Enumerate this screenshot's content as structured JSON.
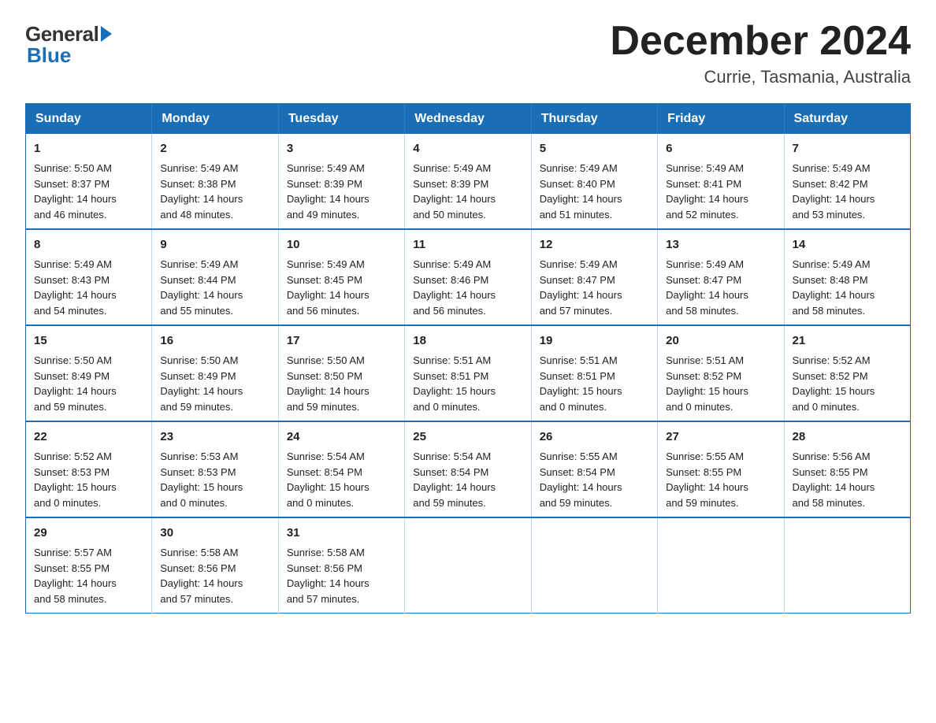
{
  "logo": {
    "general": "General",
    "blue": "Blue"
  },
  "header": {
    "month": "December 2024",
    "location": "Currie, Tasmania, Australia"
  },
  "weekdays": [
    "Sunday",
    "Monday",
    "Tuesday",
    "Wednesday",
    "Thursday",
    "Friday",
    "Saturday"
  ],
  "weeks": [
    [
      {
        "day": "1",
        "sunrise": "5:50 AM",
        "sunset": "8:37 PM",
        "daylight": "14 hours and 46 minutes."
      },
      {
        "day": "2",
        "sunrise": "5:49 AM",
        "sunset": "8:38 PM",
        "daylight": "14 hours and 48 minutes."
      },
      {
        "day": "3",
        "sunrise": "5:49 AM",
        "sunset": "8:39 PM",
        "daylight": "14 hours and 49 minutes."
      },
      {
        "day": "4",
        "sunrise": "5:49 AM",
        "sunset": "8:39 PM",
        "daylight": "14 hours and 50 minutes."
      },
      {
        "day": "5",
        "sunrise": "5:49 AM",
        "sunset": "8:40 PM",
        "daylight": "14 hours and 51 minutes."
      },
      {
        "day": "6",
        "sunrise": "5:49 AM",
        "sunset": "8:41 PM",
        "daylight": "14 hours and 52 minutes."
      },
      {
        "day": "7",
        "sunrise": "5:49 AM",
        "sunset": "8:42 PM",
        "daylight": "14 hours and 53 minutes."
      }
    ],
    [
      {
        "day": "8",
        "sunrise": "5:49 AM",
        "sunset": "8:43 PM",
        "daylight": "14 hours and 54 minutes."
      },
      {
        "day": "9",
        "sunrise": "5:49 AM",
        "sunset": "8:44 PM",
        "daylight": "14 hours and 55 minutes."
      },
      {
        "day": "10",
        "sunrise": "5:49 AM",
        "sunset": "8:45 PM",
        "daylight": "14 hours and 56 minutes."
      },
      {
        "day": "11",
        "sunrise": "5:49 AM",
        "sunset": "8:46 PM",
        "daylight": "14 hours and 56 minutes."
      },
      {
        "day": "12",
        "sunrise": "5:49 AM",
        "sunset": "8:47 PM",
        "daylight": "14 hours and 57 minutes."
      },
      {
        "day": "13",
        "sunrise": "5:49 AM",
        "sunset": "8:47 PM",
        "daylight": "14 hours and 58 minutes."
      },
      {
        "day": "14",
        "sunrise": "5:49 AM",
        "sunset": "8:48 PM",
        "daylight": "14 hours and 58 minutes."
      }
    ],
    [
      {
        "day": "15",
        "sunrise": "5:50 AM",
        "sunset": "8:49 PM",
        "daylight": "14 hours and 59 minutes."
      },
      {
        "day": "16",
        "sunrise": "5:50 AM",
        "sunset": "8:49 PM",
        "daylight": "14 hours and 59 minutes."
      },
      {
        "day": "17",
        "sunrise": "5:50 AM",
        "sunset": "8:50 PM",
        "daylight": "14 hours and 59 minutes."
      },
      {
        "day": "18",
        "sunrise": "5:51 AM",
        "sunset": "8:51 PM",
        "daylight": "15 hours and 0 minutes."
      },
      {
        "day": "19",
        "sunrise": "5:51 AM",
        "sunset": "8:51 PM",
        "daylight": "15 hours and 0 minutes."
      },
      {
        "day": "20",
        "sunrise": "5:51 AM",
        "sunset": "8:52 PM",
        "daylight": "15 hours and 0 minutes."
      },
      {
        "day": "21",
        "sunrise": "5:52 AM",
        "sunset": "8:52 PM",
        "daylight": "15 hours and 0 minutes."
      }
    ],
    [
      {
        "day": "22",
        "sunrise": "5:52 AM",
        "sunset": "8:53 PM",
        "daylight": "15 hours and 0 minutes."
      },
      {
        "day": "23",
        "sunrise": "5:53 AM",
        "sunset": "8:53 PM",
        "daylight": "15 hours and 0 minutes."
      },
      {
        "day": "24",
        "sunrise": "5:54 AM",
        "sunset": "8:54 PM",
        "daylight": "15 hours and 0 minutes."
      },
      {
        "day": "25",
        "sunrise": "5:54 AM",
        "sunset": "8:54 PM",
        "daylight": "14 hours and 59 minutes."
      },
      {
        "day": "26",
        "sunrise": "5:55 AM",
        "sunset": "8:54 PM",
        "daylight": "14 hours and 59 minutes."
      },
      {
        "day": "27",
        "sunrise": "5:55 AM",
        "sunset": "8:55 PM",
        "daylight": "14 hours and 59 minutes."
      },
      {
        "day": "28",
        "sunrise": "5:56 AM",
        "sunset": "8:55 PM",
        "daylight": "14 hours and 58 minutes."
      }
    ],
    [
      {
        "day": "29",
        "sunrise": "5:57 AM",
        "sunset": "8:55 PM",
        "daylight": "14 hours and 58 minutes."
      },
      {
        "day": "30",
        "sunrise": "5:58 AM",
        "sunset": "8:56 PM",
        "daylight": "14 hours and 57 minutes."
      },
      {
        "day": "31",
        "sunrise": "5:58 AM",
        "sunset": "8:56 PM",
        "daylight": "14 hours and 57 minutes."
      },
      null,
      null,
      null,
      null
    ]
  ],
  "labels": {
    "sunrise": "Sunrise:",
    "sunset": "Sunset:",
    "daylight": "Daylight:"
  }
}
